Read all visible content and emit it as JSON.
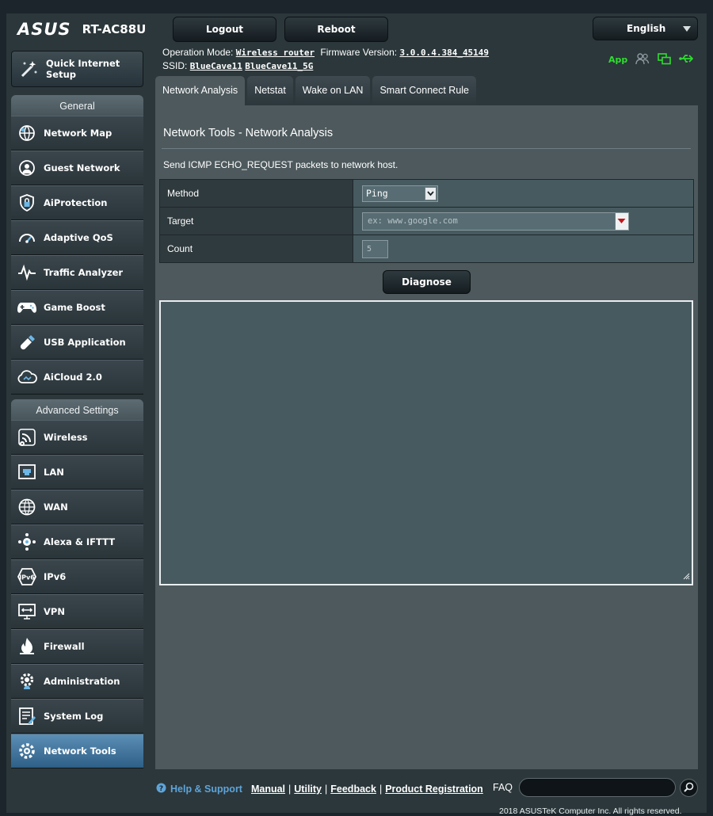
{
  "header": {
    "brand": "ASUS",
    "model": "RT-AC88U",
    "logout_label": "Logout",
    "reboot_label": "Reboot",
    "language": "English",
    "app_label": "App",
    "op_mode_label": "Operation Mode:",
    "op_mode_value": "Wireless router",
    "firmware_label": "Firmware Version:",
    "firmware_value": "3.0.0.4.384_45149",
    "ssid_label": "SSID:",
    "ssid_1": "BlueCave11",
    "ssid_2": "BlueCave11_5G"
  },
  "sidebar": {
    "quick_setup": "Quick Internet Setup",
    "general_header": "General",
    "general_items": [
      {
        "label": "Network Map",
        "icon": "network-map-icon"
      },
      {
        "label": "Guest Network",
        "icon": "guest-network-icon"
      },
      {
        "label": "AiProtection",
        "icon": "shield-lock-icon"
      },
      {
        "label": "Adaptive QoS",
        "icon": "speedometer-icon"
      },
      {
        "label": "Traffic Analyzer",
        "icon": "pulse-icon"
      },
      {
        "label": "Game Boost",
        "icon": "gamepad-icon"
      },
      {
        "label": "USB Application",
        "icon": "usb-stick-icon"
      },
      {
        "label": "AiCloud 2.0",
        "icon": "cloud-icon"
      }
    ],
    "advanced_header": "Advanced Settings",
    "advanced_items": [
      {
        "label": "Wireless",
        "icon": "wifi-icon"
      },
      {
        "label": "LAN",
        "icon": "lan-icon"
      },
      {
        "label": "WAN",
        "icon": "globe-icon"
      },
      {
        "label": "Alexa & IFTTT",
        "icon": "alexa-icon"
      },
      {
        "label": "IPv6",
        "icon": "ipv6-icon"
      },
      {
        "label": "VPN",
        "icon": "vpn-icon"
      },
      {
        "label": "Firewall",
        "icon": "firewall-icon"
      },
      {
        "label": "Administration",
        "icon": "admin-gear-icon"
      },
      {
        "label": "System Log",
        "icon": "system-log-icon"
      },
      {
        "label": "Network Tools",
        "icon": "network-tools-icon",
        "active": true
      }
    ]
  },
  "tabs": [
    "Network Analysis",
    "Netstat",
    "Wake on LAN",
    "Smart Connect Rule"
  ],
  "main": {
    "title": "Network Tools - Network Analysis",
    "description": "Send ICMP ECHO_REQUEST packets to network host.",
    "method_label": "Method",
    "method_value": "Ping",
    "target_label": "Target",
    "target_placeholder": "ex: www.google.com",
    "count_label": "Count",
    "count_value": "5",
    "diagnose_label": "Diagnose",
    "output_text": ""
  },
  "footer": {
    "help_label": "Help & Support",
    "links": [
      "Manual",
      "Utility",
      "Feedback",
      "Product Registration"
    ],
    "faq_label": "FAQ",
    "copyright": "2018 ASUSTeK Computer Inc. All rights reserved."
  },
  "colors": {
    "accent_green": "#2fdd2f",
    "active_blue": "#3f78a3",
    "help_blue": "#5ea4d8",
    "target_dropdown_red": "#c1161c"
  }
}
